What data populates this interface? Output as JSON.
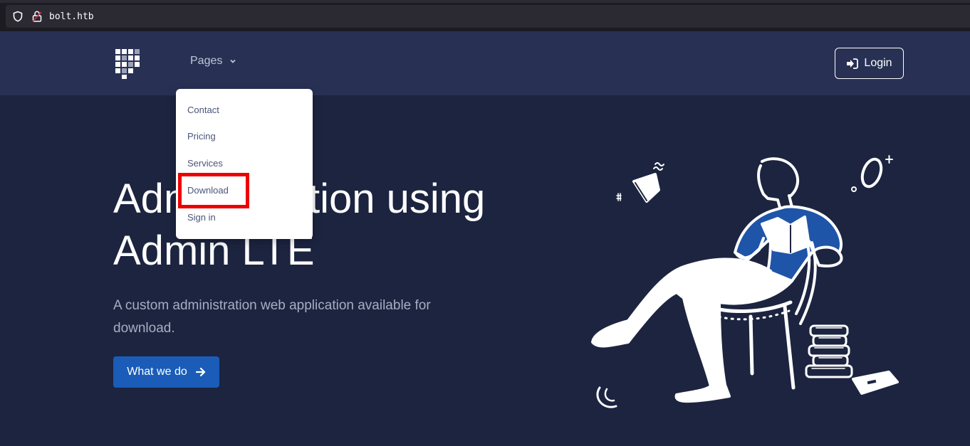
{
  "browser": {
    "url": "bolt.htb",
    "icons": [
      "shield-icon",
      "lock-icon"
    ]
  },
  "header": {
    "logo_icon": "grid-logo",
    "nav_pages_label": "Pages",
    "login_label": "Login",
    "login_icon": "sign-in-icon"
  },
  "dropdown": {
    "items": [
      "Contact",
      "Pricing",
      "Services",
      "Download",
      "Sign in"
    ],
    "highlighted": "Download"
  },
  "hero": {
    "title_line1": "Administration using",
    "title_line2": "Admin LTE",
    "subtitle": "A custom administration web application available for download.",
    "cta_label": "What we do",
    "cta_icon": "arrow-right-icon"
  },
  "colors": {
    "page_bg": "#1c2440",
    "header_bg": "#283154",
    "primary": "#1a5cb8",
    "illustration_accent": "#1f55a8",
    "highlight": "#ee0000"
  }
}
